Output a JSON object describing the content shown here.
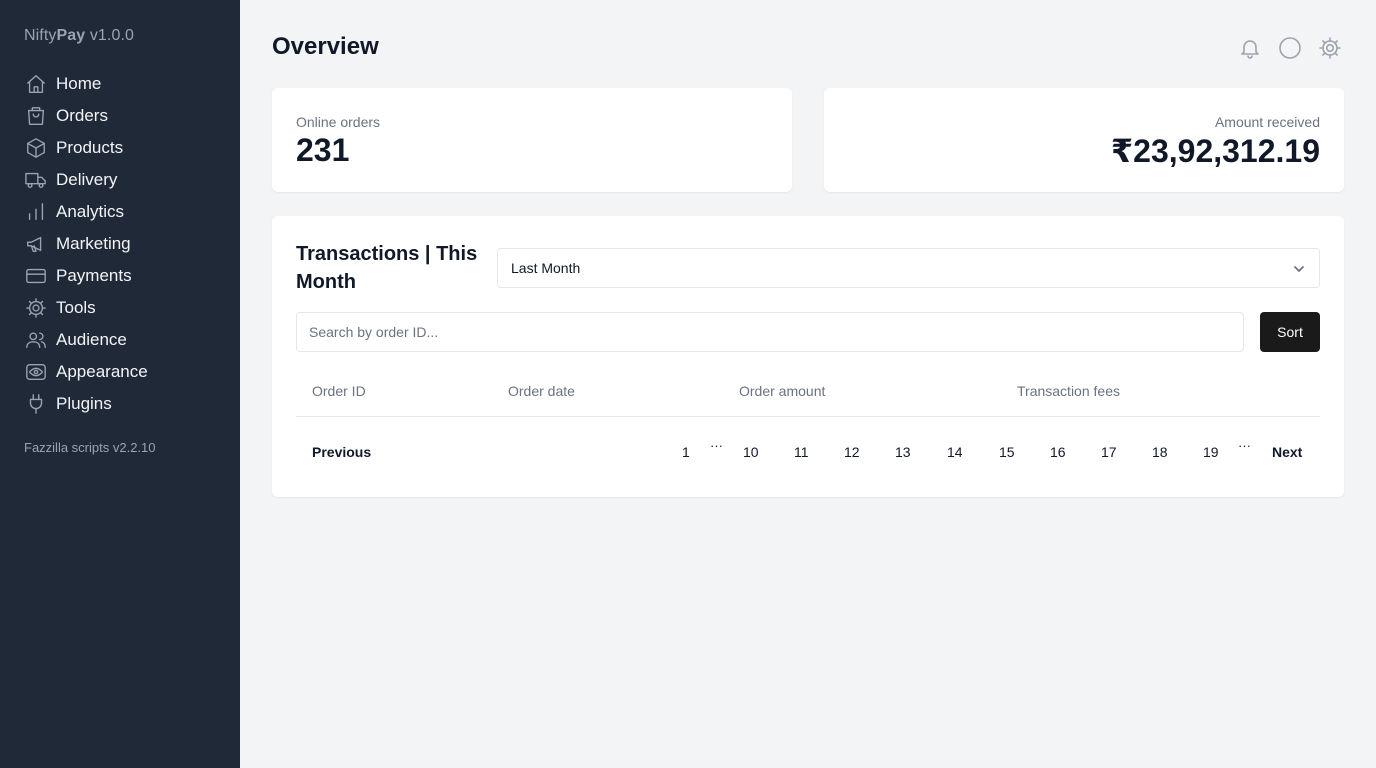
{
  "sidebar": {
    "brand_light": "Nifty",
    "brand_bold": "Pay",
    "version": "v1.0.0",
    "items": [
      {
        "label": "Home",
        "icon": "home-icon"
      },
      {
        "label": "Orders",
        "icon": "shopping-bag-icon"
      },
      {
        "label": "Products",
        "icon": "cube-icon"
      },
      {
        "label": "Delivery",
        "icon": "truck-icon"
      },
      {
        "label": "Analytics",
        "icon": "bar-chart-icon"
      },
      {
        "label": "Marketing",
        "icon": "megaphone-icon"
      },
      {
        "label": "Payments",
        "icon": "credit-card-icon"
      },
      {
        "label": "Tools",
        "icon": "gear-icon"
      },
      {
        "label": "Audience",
        "icon": "users-icon"
      },
      {
        "label": "Appearance",
        "icon": "eye-icon"
      },
      {
        "label": "Plugins",
        "icon": "plug-icon"
      }
    ],
    "footer": "Fazzilla scripts v2.2.10"
  },
  "header": {
    "title": "Overview",
    "icons": [
      "bell-icon",
      "circle-icon",
      "gear-icon"
    ]
  },
  "stats": {
    "orders": {
      "label": "Online orders",
      "value": "231"
    },
    "amount": {
      "label": "Amount received",
      "value": "₹23,92,312.19"
    }
  },
  "transactions": {
    "title": "Transactions | This Month",
    "period_selected": "Last Month",
    "search_placeholder": "Search by order ID...",
    "sort_label": "Sort",
    "columns": [
      "Order ID",
      "Order date",
      "Order amount",
      "Transaction fees"
    ],
    "pagination": {
      "previous": "Previous",
      "next": "Next",
      "ellipsis": "···",
      "pages": [
        "1",
        "10",
        "11",
        "12",
        "13",
        "14",
        "15",
        "16",
        "17",
        "18",
        "19"
      ]
    }
  },
  "colors": {
    "sidebar_bg": "#1f2937",
    "page_bg": "#f3f4f6",
    "button_bg": "#1a1a1a"
  }
}
